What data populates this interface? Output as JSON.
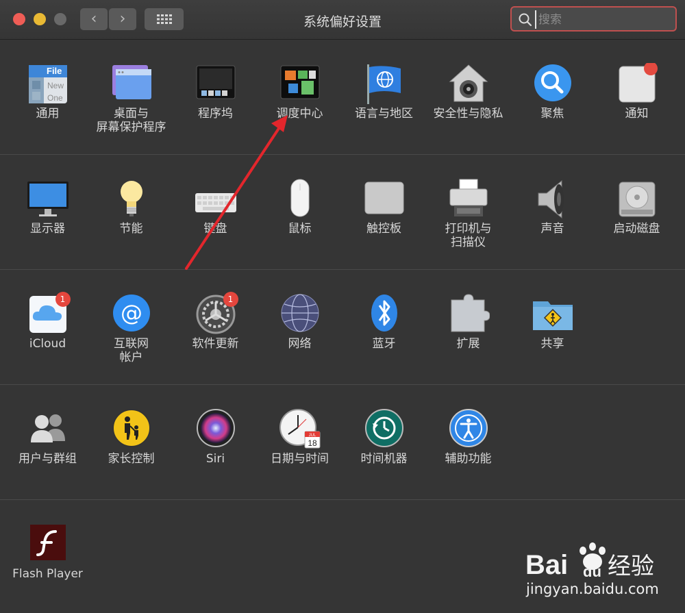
{
  "window": {
    "title": "系统偏好设置",
    "nav_back": "‹",
    "nav_forward": "›"
  },
  "search": {
    "placeholder": "搜索",
    "value": ""
  },
  "rows": [
    [
      {
        "label": "通用",
        "icon": "general-icon"
      },
      {
        "label": "桌面与\n屏幕保护程序",
        "icon": "desktop-screensaver-icon"
      },
      {
        "label": "程序坞",
        "icon": "dock-icon"
      },
      {
        "label": "调度中心",
        "icon": "mission-control-icon"
      },
      {
        "label": "语言与地区",
        "icon": "language-region-icon"
      },
      {
        "label": "安全性与隐私",
        "icon": "security-privacy-icon"
      },
      {
        "label": "聚焦",
        "icon": "spotlight-icon"
      },
      {
        "label": "通知",
        "icon": "notifications-icon"
      }
    ],
    [
      {
        "label": "显示器",
        "icon": "displays-icon"
      },
      {
        "label": "节能",
        "icon": "energy-saver-icon"
      },
      {
        "label": "键盘",
        "icon": "keyboard-icon"
      },
      {
        "label": "鼠标",
        "icon": "mouse-icon"
      },
      {
        "label": "触控板",
        "icon": "trackpad-icon"
      },
      {
        "label": "打印机与\n扫描仪",
        "icon": "printers-scanners-icon"
      },
      {
        "label": "声音",
        "icon": "sound-icon"
      },
      {
        "label": "启动磁盘",
        "icon": "startup-disk-icon"
      }
    ],
    [
      {
        "label": "iCloud",
        "icon": "icloud-icon",
        "badge": "1"
      },
      {
        "label": "互联网\n帐户",
        "icon": "internet-accounts-icon"
      },
      {
        "label": "软件更新",
        "icon": "software-update-icon",
        "badge": "1"
      },
      {
        "label": "网络",
        "icon": "network-icon"
      },
      {
        "label": "蓝牙",
        "icon": "bluetooth-icon"
      },
      {
        "label": "扩展",
        "icon": "extensions-icon"
      },
      {
        "label": "共享",
        "icon": "sharing-icon"
      }
    ],
    [
      {
        "label": "用户与群组",
        "icon": "users-groups-icon"
      },
      {
        "label": "家长控制",
        "icon": "parental-controls-icon"
      },
      {
        "label": "Siri",
        "icon": "siri-icon"
      },
      {
        "label": "日期与时间",
        "icon": "date-time-icon",
        "icon_text": "JUL",
        "icon_day": "18"
      },
      {
        "label": "时间机器",
        "icon": "time-machine-icon"
      },
      {
        "label": "辅助功能",
        "icon": "accessibility-icon"
      }
    ],
    [
      {
        "label": "Flash Player",
        "icon": "flash-player-icon"
      }
    ]
  ],
  "general_icon_text": [
    "File",
    "New",
    "One"
  ],
  "watermark": {
    "brand": "Bai",
    "brand2": "du",
    "brand_cn": "经验",
    "url": "jingyan.baidu.com"
  },
  "colors": {
    "close": "#ef5d56",
    "minimize": "#e9b934",
    "search_border": "#c0504f",
    "annotation_arrow": "#e3262c"
  }
}
